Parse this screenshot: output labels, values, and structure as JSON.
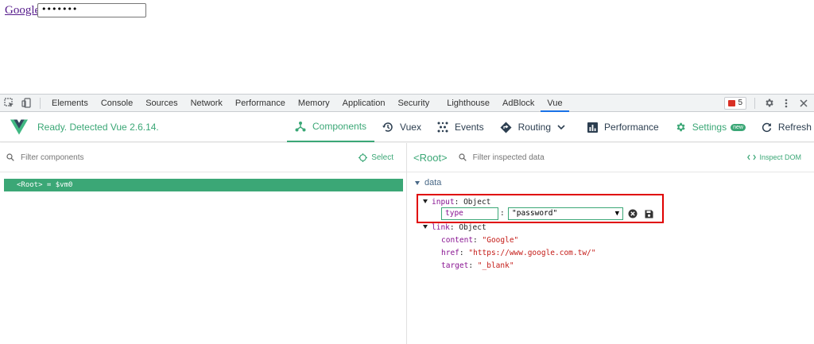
{
  "page": {
    "link_text": "Google",
    "password_value": "•••••••"
  },
  "devtools": {
    "tabs": [
      "Elements",
      "Console",
      "Sources",
      "Network",
      "Performance",
      "Memory",
      "Application",
      "Security",
      "Lighthouse",
      "AdBlock",
      "Vue"
    ],
    "active_tab": "Vue",
    "error_count": "5"
  },
  "vue_header": {
    "status": "Ready. Detected Vue 2.6.14.",
    "nav": {
      "components": "Components",
      "vuex": "Vuex",
      "events": "Events",
      "routing": "Routing",
      "performance": "Performance",
      "settings": "Settings",
      "settings_badge": "new",
      "refresh": "Refresh"
    },
    "accent": "#3ba776"
  },
  "left_panel": {
    "filter_placeholder": "Filter components",
    "select_label": "Select",
    "root_row": "<Root> = $vm0"
  },
  "right_panel": {
    "title": "<Root>",
    "filter_placeholder": "Filter inspected data",
    "inspect_dom": "Inspect DOM",
    "section": "data",
    "input_key": "input",
    "input_type": "Object",
    "edit_key": "type",
    "edit_sep": ":",
    "edit_value": "\"password\"",
    "link_key": "link",
    "link_type": "Object",
    "props": [
      {
        "key": "content",
        "value": "\"Google\""
      },
      {
        "key": "href",
        "value": "\"https://www.google.com.tw/\""
      },
      {
        "key": "target",
        "value": "\"_blank\""
      }
    ]
  }
}
